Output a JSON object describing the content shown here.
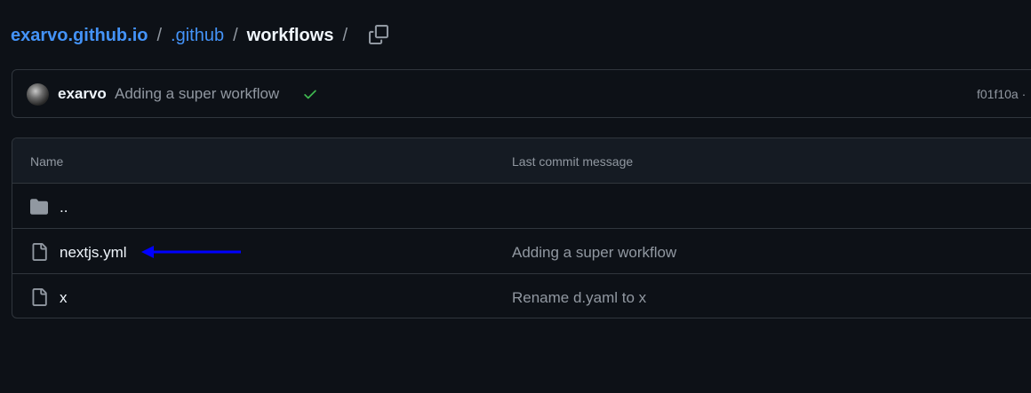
{
  "breadcrumb": {
    "repo": "exarvo.github.io",
    "folder": ".github",
    "current": "workflows",
    "separator": "/"
  },
  "icons": {
    "copy": "copy-icon",
    "check": "check-icon",
    "folder": "folder-icon",
    "file": "file-icon",
    "arrow": "arrow-left-annotation"
  },
  "latest_commit": {
    "author": "exarvo",
    "message": "Adding a super workflow",
    "status": "success",
    "sha": "f01f10a ·"
  },
  "table": {
    "columns": [
      "Name",
      "Last commit message"
    ],
    "rows": [
      {
        "type": "folder",
        "name": "..",
        "message": ""
      },
      {
        "type": "file",
        "name": "nextjs.yml",
        "message": "Adding a super workflow"
      },
      {
        "type": "file",
        "name": "x",
        "message": "Rename d.yaml to x"
      }
    ]
  },
  "colors": {
    "background": "#0d1117",
    "link": "#4493f8",
    "border": "#30363d",
    "success": "#3fb950",
    "annotation_arrow": "#0000ff"
  }
}
